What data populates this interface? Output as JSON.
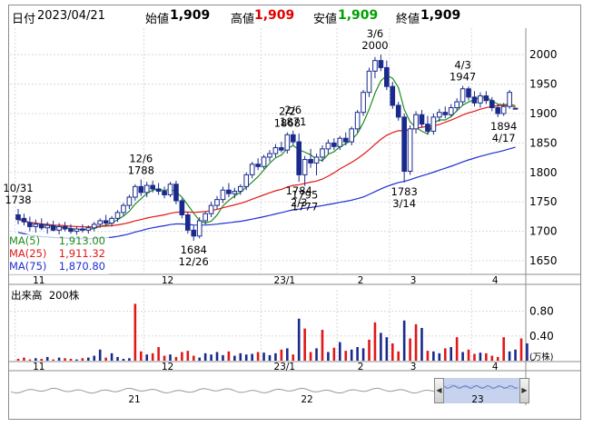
{
  "header": {
    "date_label": "日付",
    "date": "2023/04/21",
    "open_label": "始値",
    "open": "1,909",
    "high_label": "高値",
    "high": "1,909",
    "low_label": "安値",
    "low": "1,909",
    "close_label": "終値",
    "close": "1,909"
  },
  "colors": {
    "up": "#1a2a8c",
    "down": "#1a2a8c",
    "ma5": "#1e8c1e",
    "ma25": "#e01818",
    "ma75": "#1f2fd0",
    "high_text": "#e00000",
    "low_text": "#00a000",
    "volume_up": "#1a2a8c",
    "volume_down": "#e01818"
  },
  "legend": {
    "ma5": {
      "label": "MA(5)",
      "value": "1,913.00"
    },
    "ma25": {
      "label": "MA(25)",
      "value": "1,911.32"
    },
    "ma75": {
      "label": "MA(75)",
      "value": "1,870.80"
    }
  },
  "volume_panel": {
    "title": "出来高",
    "unit_label": "200株",
    "ticks": [
      "0.80",
      "0.40"
    ],
    "unit": "(万株)"
  },
  "navigator": {
    "labels": [
      "21",
      "22",
      "23"
    ],
    "left_button": "◀",
    "right_button": "▶"
  },
  "chart_data": {
    "type": "candlestick",
    "price_axis": {
      "ticks": [
        1650,
        1700,
        1750,
        1800,
        1850,
        1900,
        1950,
        2000
      ],
      "range": [
        1630,
        2045
      ]
    },
    "month_labels": [
      "11",
      "12",
      "23/1",
      "2",
      "3",
      "4"
    ],
    "candles": [
      {
        "o": 1728,
        "h": 1738,
        "l": 1712,
        "c": 1720
      },
      {
        "o": 1722,
        "h": 1730,
        "l": 1710,
        "c": 1716
      },
      {
        "o": 1715,
        "h": 1725,
        "l": 1700,
        "c": 1708
      },
      {
        "o": 1708,
        "h": 1720,
        "l": 1698,
        "c": 1712
      },
      {
        "o": 1712,
        "h": 1722,
        "l": 1702,
        "c": 1706
      },
      {
        "o": 1706,
        "h": 1716,
        "l": 1696,
        "c": 1710
      },
      {
        "o": 1710,
        "h": 1718,
        "l": 1700,
        "c": 1702
      },
      {
        "o": 1702,
        "h": 1714,
        "l": 1694,
        "c": 1708
      },
      {
        "o": 1708,
        "h": 1716,
        "l": 1700,
        "c": 1704
      },
      {
        "o": 1704,
        "h": 1712,
        "l": 1696,
        "c": 1700
      },
      {
        "o": 1700,
        "h": 1708,
        "l": 1692,
        "c": 1704
      },
      {
        "o": 1704,
        "h": 1712,
        "l": 1698,
        "c": 1702
      },
      {
        "o": 1702,
        "h": 1710,
        "l": 1696,
        "c": 1706
      },
      {
        "o": 1706,
        "h": 1716,
        "l": 1700,
        "c": 1712
      },
      {
        "o": 1712,
        "h": 1722,
        "l": 1706,
        "c": 1718
      },
      {
        "o": 1718,
        "h": 1728,
        "l": 1710,
        "c": 1714
      },
      {
        "o": 1714,
        "h": 1726,
        "l": 1708,
        "c": 1722
      },
      {
        "o": 1722,
        "h": 1736,
        "l": 1716,
        "c": 1732
      },
      {
        "o": 1732,
        "h": 1748,
        "l": 1726,
        "c": 1744
      },
      {
        "o": 1744,
        "h": 1762,
        "l": 1738,
        "c": 1758
      },
      {
        "o": 1758,
        "h": 1780,
        "l": 1752,
        "c": 1776
      },
      {
        "o": 1776,
        "h": 1788,
        "l": 1760,
        "c": 1766
      },
      {
        "o": 1766,
        "h": 1784,
        "l": 1758,
        "c": 1778
      },
      {
        "o": 1778,
        "h": 1786,
        "l": 1766,
        "c": 1772
      },
      {
        "o": 1772,
        "h": 1782,
        "l": 1762,
        "c": 1768
      },
      {
        "o": 1768,
        "h": 1776,
        "l": 1756,
        "c": 1762
      },
      {
        "o": 1762,
        "h": 1784,
        "l": 1758,
        "c": 1780
      },
      {
        "o": 1780,
        "h": 1786,
        "l": 1746,
        "c": 1752
      },
      {
        "o": 1752,
        "h": 1756,
        "l": 1722,
        "c": 1728
      },
      {
        "o": 1728,
        "h": 1732,
        "l": 1696,
        "c": 1702
      },
      {
        "o": 1702,
        "h": 1710,
        "l": 1684,
        "c": 1692
      },
      {
        "o": 1692,
        "h": 1724,
        "l": 1688,
        "c": 1718
      },
      {
        "o": 1718,
        "h": 1734,
        "l": 1712,
        "c": 1730
      },
      {
        "o": 1730,
        "h": 1750,
        "l": 1724,
        "c": 1744
      },
      {
        "o": 1744,
        "h": 1760,
        "l": 1738,
        "c": 1754
      },
      {
        "o": 1754,
        "h": 1776,
        "l": 1748,
        "c": 1770
      },
      {
        "o": 1770,
        "h": 1782,
        "l": 1758,
        "c": 1764
      },
      {
        "o": 1764,
        "h": 1774,
        "l": 1756,
        "c": 1768
      },
      {
        "o": 1768,
        "h": 1780,
        "l": 1762,
        "c": 1776
      },
      {
        "o": 1776,
        "h": 1800,
        "l": 1770,
        "c": 1796
      },
      {
        "o": 1796,
        "h": 1818,
        "l": 1790,
        "c": 1814
      },
      {
        "o": 1814,
        "h": 1824,
        "l": 1804,
        "c": 1810
      },
      {
        "o": 1810,
        "h": 1830,
        "l": 1806,
        "c": 1826
      },
      {
        "o": 1826,
        "h": 1838,
        "l": 1818,
        "c": 1832
      },
      {
        "o": 1832,
        "h": 1848,
        "l": 1826,
        "c": 1842
      },
      {
        "o": 1842,
        "h": 1852,
        "l": 1834,
        "c": 1838
      },
      {
        "o": 1838,
        "h": 1868,
        "l": 1832,
        "c": 1864
      },
      {
        "o": 1864,
        "h": 1871,
        "l": 1846,
        "c": 1852
      },
      {
        "o": 1852,
        "h": 1866,
        "l": 1784,
        "c": 1796
      },
      {
        "o": 1796,
        "h": 1828,
        "l": 1777,
        "c": 1822
      },
      {
        "o": 1822,
        "h": 1840,
        "l": 1808,
        "c": 1816
      },
      {
        "o": 1816,
        "h": 1832,
        "l": 1795,
        "c": 1826
      },
      {
        "o": 1826,
        "h": 1846,
        "l": 1818,
        "c": 1840
      },
      {
        "o": 1840,
        "h": 1856,
        "l": 1832,
        "c": 1850
      },
      {
        "o": 1850,
        "h": 1858,
        "l": 1838,
        "c": 1844
      },
      {
        "o": 1844,
        "h": 1862,
        "l": 1838,
        "c": 1858
      },
      {
        "o": 1858,
        "h": 1868,
        "l": 1846,
        "c": 1852
      },
      {
        "o": 1852,
        "h": 1878,
        "l": 1846,
        "c": 1874
      },
      {
        "o": 1874,
        "h": 1906,
        "l": 1868,
        "c": 1902
      },
      {
        "o": 1902,
        "h": 1940,
        "l": 1896,
        "c": 1936
      },
      {
        "o": 1936,
        "h": 1978,
        "l": 1928,
        "c": 1972
      },
      {
        "o": 1972,
        "h": 1996,
        "l": 1960,
        "c": 1990
      },
      {
        "o": 1990,
        "h": 2000,
        "l": 1972,
        "c": 1978
      },
      {
        "o": 1978,
        "h": 1990,
        "l": 1940,
        "c": 1946
      },
      {
        "o": 1946,
        "h": 1954,
        "l": 1908,
        "c": 1914
      },
      {
        "o": 1914,
        "h": 1920,
        "l": 1888,
        "c": 1894
      },
      {
        "o": 1894,
        "h": 1900,
        "l": 1783,
        "c": 1802
      },
      {
        "o": 1802,
        "h": 1880,
        "l": 1796,
        "c": 1874
      },
      {
        "o": 1874,
        "h": 1904,
        "l": 1866,
        "c": 1898
      },
      {
        "o": 1898,
        "h": 1906,
        "l": 1876,
        "c": 1882
      },
      {
        "o": 1882,
        "h": 1896,
        "l": 1864,
        "c": 1870
      },
      {
        "o": 1870,
        "h": 1900,
        "l": 1864,
        "c": 1894
      },
      {
        "o": 1894,
        "h": 1908,
        "l": 1886,
        "c": 1902
      },
      {
        "o": 1902,
        "h": 1912,
        "l": 1892,
        "c": 1898
      },
      {
        "o": 1898,
        "h": 1916,
        "l": 1894,
        "c": 1910
      },
      {
        "o": 1910,
        "h": 1926,
        "l": 1904,
        "c": 1920
      },
      {
        "o": 1920,
        "h": 1947,
        "l": 1914,
        "c": 1942
      },
      {
        "o": 1942,
        "h": 1946,
        "l": 1922,
        "c": 1928
      },
      {
        "o": 1928,
        "h": 1938,
        "l": 1912,
        "c": 1918
      },
      {
        "o": 1918,
        "h": 1936,
        "l": 1910,
        "c": 1930
      },
      {
        "o": 1930,
        "h": 1938,
        "l": 1916,
        "c": 1922
      },
      {
        "o": 1922,
        "h": 1928,
        "l": 1904,
        "c": 1910
      },
      {
        "o": 1910,
        "h": 1916,
        "l": 1894,
        "c": 1900
      },
      {
        "o": 1900,
        "h": 1918,
        "l": 1896,
        "c": 1912
      },
      {
        "o": 1912,
        "h": 1940,
        "l": 1908,
        "c": 1936
      },
      {
        "o": 1909,
        "h": 1909,
        "l": 1909,
        "c": 1909
      }
    ],
    "annotations": [
      {
        "i": 0,
        "price": 1738,
        "text": [
          "10/31",
          "1738"
        ],
        "pos": "above"
      },
      {
        "i": 21,
        "price": 1788,
        "text": [
          "12/6",
          "1788"
        ],
        "pos": "above"
      },
      {
        "i": 30,
        "price": 1684,
        "text": [
          "1684",
          "12/26"
        ],
        "pos": "below"
      },
      {
        "i": 46,
        "price": 1868,
        "text": [
          "2/2",
          "1868"
        ],
        "pos": "above"
      },
      {
        "i": 47,
        "price": 1871,
        "text": [
          "2/6",
          "1871"
        ],
        "pos": "above"
      },
      {
        "i": 48,
        "price": 1784,
        "text": [
          "1784",
          "2/3"
        ],
        "pos": "below"
      },
      {
        "i": 49,
        "price": 1777,
        "text": [
          "1795",
          "1777"
        ],
        "pos": "below"
      },
      {
        "i": 61,
        "price": 2000,
        "text": [
          "3/6",
          "2000"
        ],
        "pos": "above"
      },
      {
        "i": 66,
        "price": 1783,
        "text": [
          "1783",
          "3/14"
        ],
        "pos": "below"
      },
      {
        "i": 76,
        "price": 1947,
        "text": [
          "4/3",
          "1947"
        ],
        "pos": "above"
      },
      {
        "i": 83,
        "price": 1894,
        "text": [
          "1894",
          "4/17"
        ],
        "pos": "below"
      }
    ],
    "volume_ticks": [
      0.8,
      0.4
    ],
    "volume_range": [
      0,
      1.0
    ],
    "volumes": [
      0.03,
      0.05,
      0.02,
      0.04,
      0.03,
      0.06,
      0.02,
      0.05,
      0.04,
      0.03,
      0.02,
      0.04,
      0.05,
      0.08,
      0.18,
      0.05,
      0.12,
      0.06,
      0.03,
      0.04,
      0.92,
      0.15,
      0.1,
      0.12,
      0.22,
      0.08,
      0.1,
      0.06,
      0.14,
      0.16,
      0.08,
      0.05,
      0.12,
      0.1,
      0.14,
      0.09,
      0.15,
      0.08,
      0.12,
      0.1,
      0.11,
      0.14,
      0.13,
      0.09,
      0.12,
      0.18,
      0.2,
      0.1,
      0.68,
      0.52,
      0.14,
      0.2,
      0.5,
      0.14,
      0.21,
      0.3,
      0.16,
      0.18,
      0.22,
      0.2,
      0.34,
      0.62,
      0.45,
      0.38,
      0.28,
      0.15,
      0.65,
      0.36,
      0.59,
      0.53,
      0.16,
      0.15,
      0.12,
      0.2,
      0.22,
      0.38,
      0.14,
      0.18,
      0.11,
      0.13,
      0.12,
      0.08,
      0.06,
      0.38,
      0.15,
      0.18,
      0.36,
      0.28,
      0.02
    ],
    "series": [
      {
        "name": "MA(5)",
        "key": "ma5"
      },
      {
        "name": "MA(25)",
        "key": "ma25"
      },
      {
        "name": "MA(75)",
        "key": "ma75"
      }
    ]
  }
}
